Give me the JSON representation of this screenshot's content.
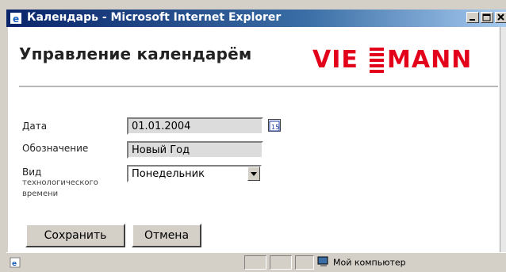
{
  "window": {
    "title": "Календарь - Microsoft Internet Explorer"
  },
  "page": {
    "heading": "Управление календарём",
    "logo_text": "VIESMANN",
    "brand_color": "#e2001a"
  },
  "form": {
    "date_label": "Дата",
    "date_value": "01.01.2004",
    "name_label": "Обозначение",
    "name_value": "Новый Год",
    "kind_label_line1": "Вид",
    "kind_label_line2": "технологического",
    "kind_label_line3": "времени",
    "kind_value": "Понедельник"
  },
  "buttons": {
    "save": "Сохранить",
    "cancel": "Отмена"
  },
  "status": {
    "zone": "Мой компьютер"
  },
  "icons": [
    "ie-icon",
    "minimize-icon",
    "maximize-icon",
    "close-icon",
    "calendar-icon",
    "chevron-down-icon",
    "computer-icon"
  ]
}
